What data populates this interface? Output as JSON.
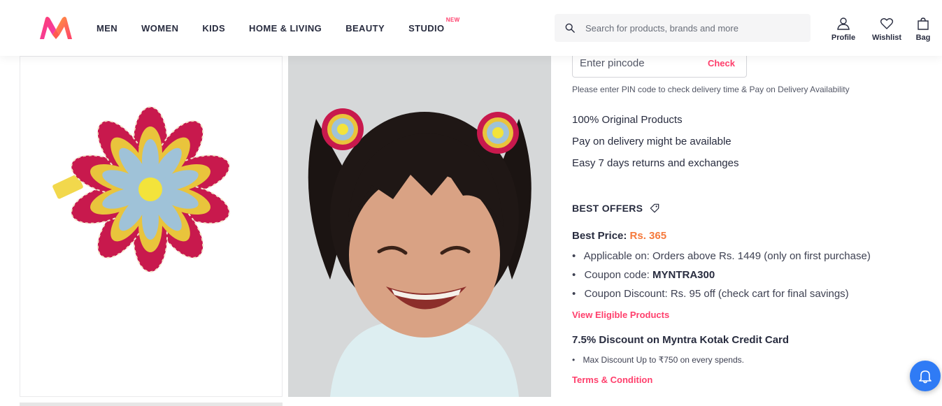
{
  "nav": {
    "items": [
      {
        "label": "MEN"
      },
      {
        "label": "WOMEN"
      },
      {
        "label": "KIDS"
      },
      {
        "label": "HOME & LIVING"
      },
      {
        "label": "BEAUTY"
      },
      {
        "label": "STUDIO",
        "badge": "NEW"
      }
    ]
  },
  "search": {
    "placeholder": "Search for products, brands and more"
  },
  "actions": {
    "profile": "Profile",
    "wishlist": "Wishlist",
    "bag": "Bag"
  },
  "pincode": {
    "placeholder": "Enter pincode",
    "check_label": "Check",
    "note": "Please enter PIN code to check delivery time & Pay on Delivery Availability"
  },
  "features": [
    "100% Original Products",
    "Pay on delivery might be available",
    "Easy 7 days returns and exchanges"
  ],
  "offers": {
    "title": "BEST OFFERS",
    "best_price_label": "Best Price:",
    "best_price_value": "Rs. 365",
    "applicable": "Applicable on: Orders above Rs. 1449 (only on first purchase)",
    "coupon_code_label": "Coupon code: ",
    "coupon_code": "MYNTRA300",
    "coupon_discount": "Coupon Discount: Rs. 95 off (check cart for final savings)",
    "view_eligible": "View Eligible Products",
    "card_title": "7.5% Discount on Myntra Kotak Credit Card",
    "card_note": "Max Discount Up to ₹750 on every spends.",
    "terms": "Terms & Condition"
  },
  "colors": {
    "accent": "#ff3f6c",
    "price": "#f5793b",
    "bell": "#2f7bf5"
  },
  "icons": [
    "search-icon",
    "profile-icon",
    "wishlist-icon",
    "bag-icon",
    "tag-icon",
    "bell-icon"
  ]
}
